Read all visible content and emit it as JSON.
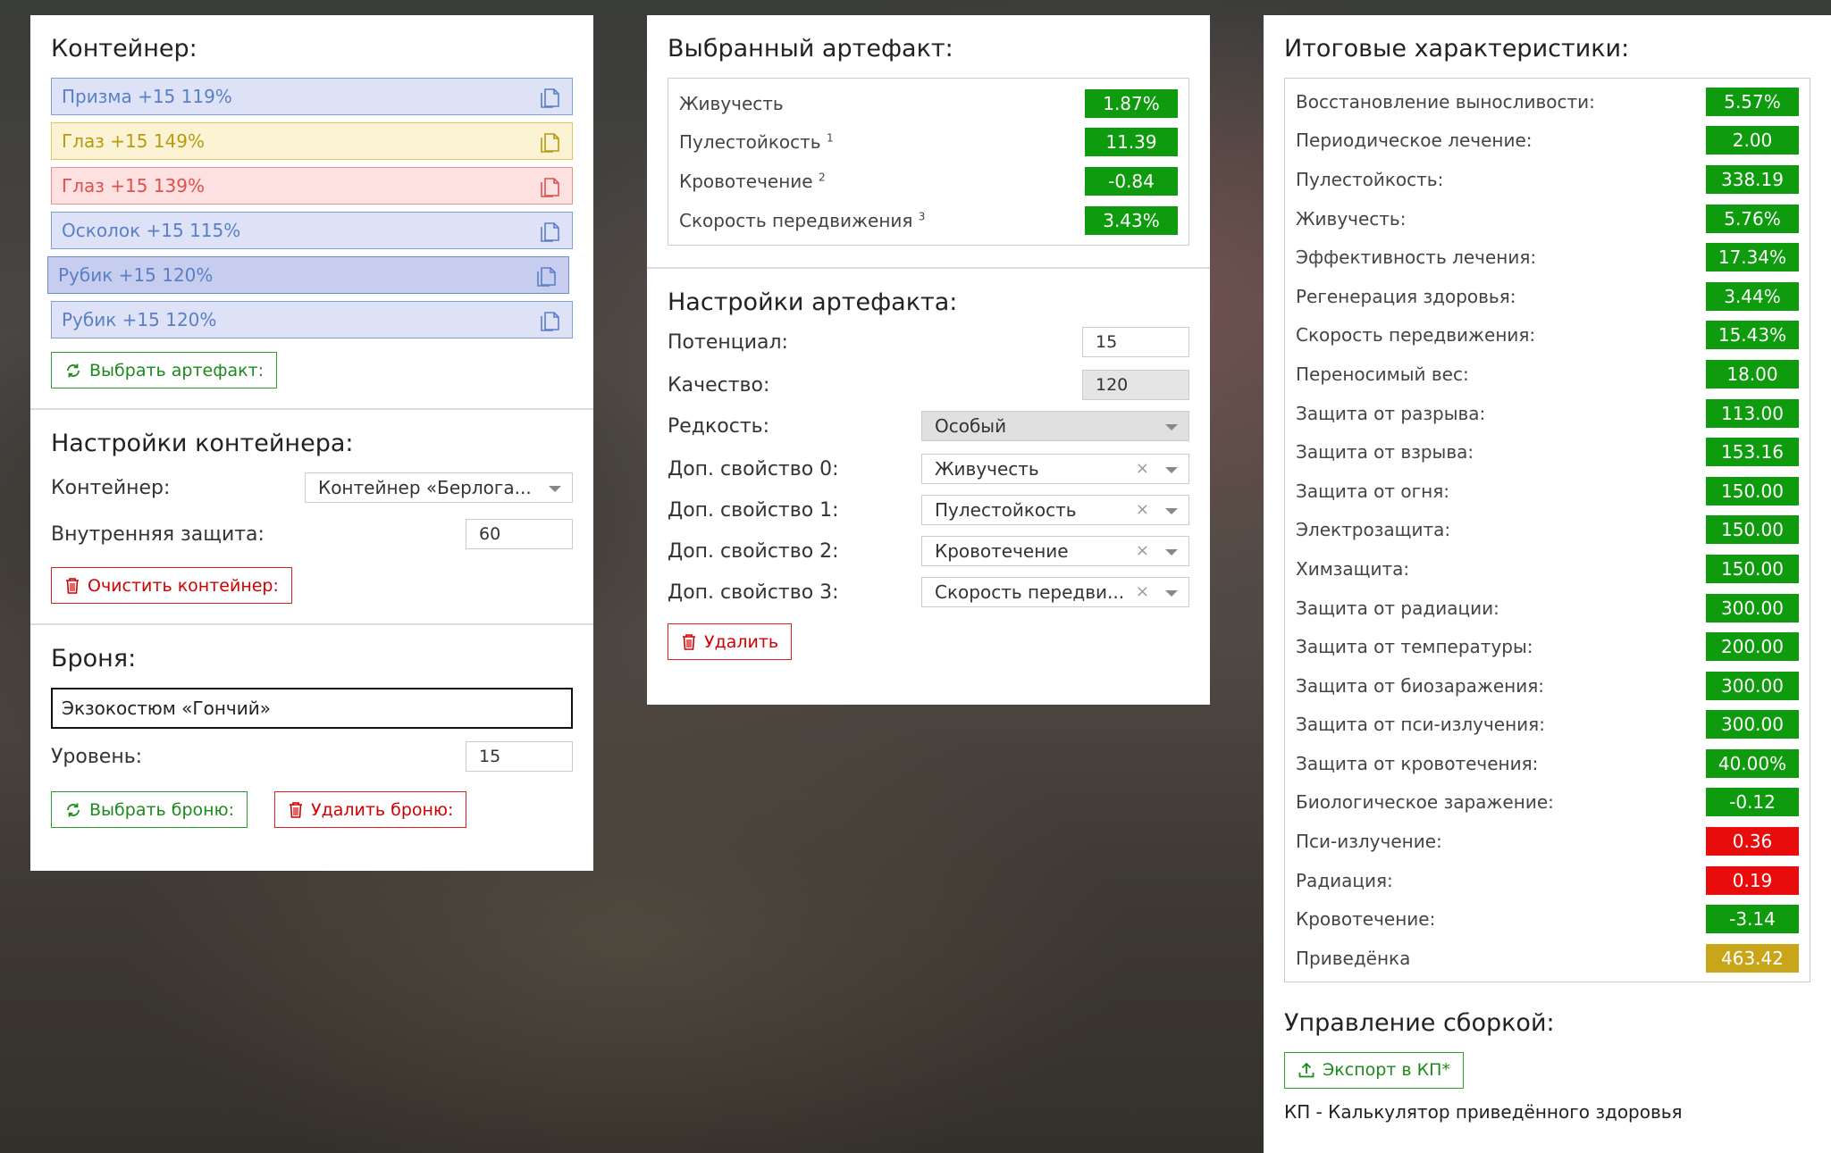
{
  "container_panel": {
    "title": "Контейнер:",
    "artifacts": [
      {
        "label": "Призма +15 119%",
        "color": "blue"
      },
      {
        "label": "Глаз +15 149%",
        "color": "yellow"
      },
      {
        "label": "Глаз +15 139%",
        "color": "red"
      },
      {
        "label": "Осколок +15 115%",
        "color": "blue"
      },
      {
        "label": "Рубик +15 120%",
        "color": "blue-selected"
      },
      {
        "label": "Рубик +15 120%",
        "color": "blue"
      }
    ],
    "select_artifact_label": "Выбрать артефакт:",
    "settings_title": "Настройки контейнера:",
    "container_label": "Контейнер:",
    "container_value": "Контейнер «Берлога...",
    "inner_protection_label": "Внутренняя защита:",
    "inner_protection_value": "60",
    "clear_label": "Очистить контейнер:",
    "armor_title": "Броня:",
    "armor_value": "Экзокостюм «Гончий»",
    "level_label": "Уровень:",
    "level_value": "15",
    "select_armor_label": "Выбрать броню:",
    "delete_armor_label": "Удалить броню:"
  },
  "artifact_panel": {
    "title": "Выбранный артефакт:",
    "stats": [
      {
        "name": "Живучесть",
        "sup": "",
        "value": "1.87%",
        "status": "good"
      },
      {
        "name": "Пулестойкость",
        "sup": "1",
        "value": "11.39",
        "status": "good"
      },
      {
        "name": "Кровотечение",
        "sup": "2",
        "value": "-0.84",
        "status": "good"
      },
      {
        "name": "Скорость передвижения",
        "sup": "3",
        "value": "3.43%",
        "status": "good"
      }
    ],
    "settings_title": "Настройки артефакта:",
    "potential_label": "Потенциал:",
    "potential_value": "15",
    "quality_label": "Качество:",
    "quality_value": "120",
    "rarity_label": "Редкость:",
    "rarity_value": "Особый",
    "extra_props": [
      {
        "label": "Доп. свойство 0:",
        "value": "Живучесть"
      },
      {
        "label": "Доп. свойство 1:",
        "value": "Пулестойкость"
      },
      {
        "label": "Доп. свойство 2:",
        "value": "Кровотечение"
      },
      {
        "label": "Доп. свойство 3:",
        "value": "Скорость передви..."
      }
    ],
    "clear_glyph": "×",
    "delete_label": "Удалить"
  },
  "totals_panel": {
    "title": "Итоговые характеристики:",
    "stats": [
      {
        "name": "Восстановление выносливости:",
        "value": "5.57%",
        "status": "good"
      },
      {
        "name": "Периодическое лечение:",
        "value": "2.00",
        "status": "good"
      },
      {
        "name": "Пулестойкость:",
        "value": "338.19",
        "status": "good"
      },
      {
        "name": "Живучесть:",
        "value": "5.76%",
        "status": "good"
      },
      {
        "name": "Эффективность лечения:",
        "value": "17.34%",
        "status": "good"
      },
      {
        "name": "Регенерация здоровья:",
        "value": "3.44%",
        "status": "good"
      },
      {
        "name": "Скорость передвижения:",
        "value": "15.43%",
        "status": "good"
      },
      {
        "name": "Переносимый вес:",
        "value": "18.00",
        "status": "good"
      },
      {
        "name": "Защита от разрыва:",
        "value": "113.00",
        "status": "good"
      },
      {
        "name": "Защита от взрыва:",
        "value": "153.16",
        "status": "good"
      },
      {
        "name": "Защита от огня:",
        "value": "150.00",
        "status": "good"
      },
      {
        "name": "Электрозащита:",
        "value": "150.00",
        "status": "good"
      },
      {
        "name": "Химзащита:",
        "value": "150.00",
        "status": "good"
      },
      {
        "name": "Защита от радиации:",
        "value": "300.00",
        "status": "good"
      },
      {
        "name": "Защита от температуры:",
        "value": "200.00",
        "status": "good"
      },
      {
        "name": "Защита от биозаражения:",
        "value": "300.00",
        "status": "good"
      },
      {
        "name": "Защита от пси-излучения:",
        "value": "300.00",
        "status": "good"
      },
      {
        "name": "Защита от кровотечения:",
        "value": "40.00%",
        "status": "good"
      },
      {
        "name": "Биологическое заражение:",
        "value": "-0.12",
        "status": "good"
      },
      {
        "name": "Пси-излучение:",
        "value": "0.36",
        "status": "bad"
      },
      {
        "name": "Радиация:",
        "value": "0.19",
        "status": "bad"
      },
      {
        "name": "Кровотечение:",
        "value": "-3.14",
        "status": "good"
      },
      {
        "name": "Приведёнка",
        "value": "463.42",
        "status": "neutral"
      }
    ],
    "build_title": "Управление сборкой:",
    "export_label": "Экспорт в КП*",
    "footnote": "КП - Калькулятор приведённого здоровья"
  },
  "colors": {
    "good": "#0e9b0e",
    "bad": "#e80c0c",
    "neutral": "#c9a51a",
    "blue_bg": "#dde2f6",
    "blue_border": "#7e9fd8",
    "blue_text": "#5a7fc8",
    "yellow_bg": "#fbf3d4",
    "yellow_border": "#e2c84e",
    "yellow_text": "#b89a10",
    "red_bg": "#fde0e0",
    "red_border": "#ef9090",
    "red_text": "#e05050"
  }
}
